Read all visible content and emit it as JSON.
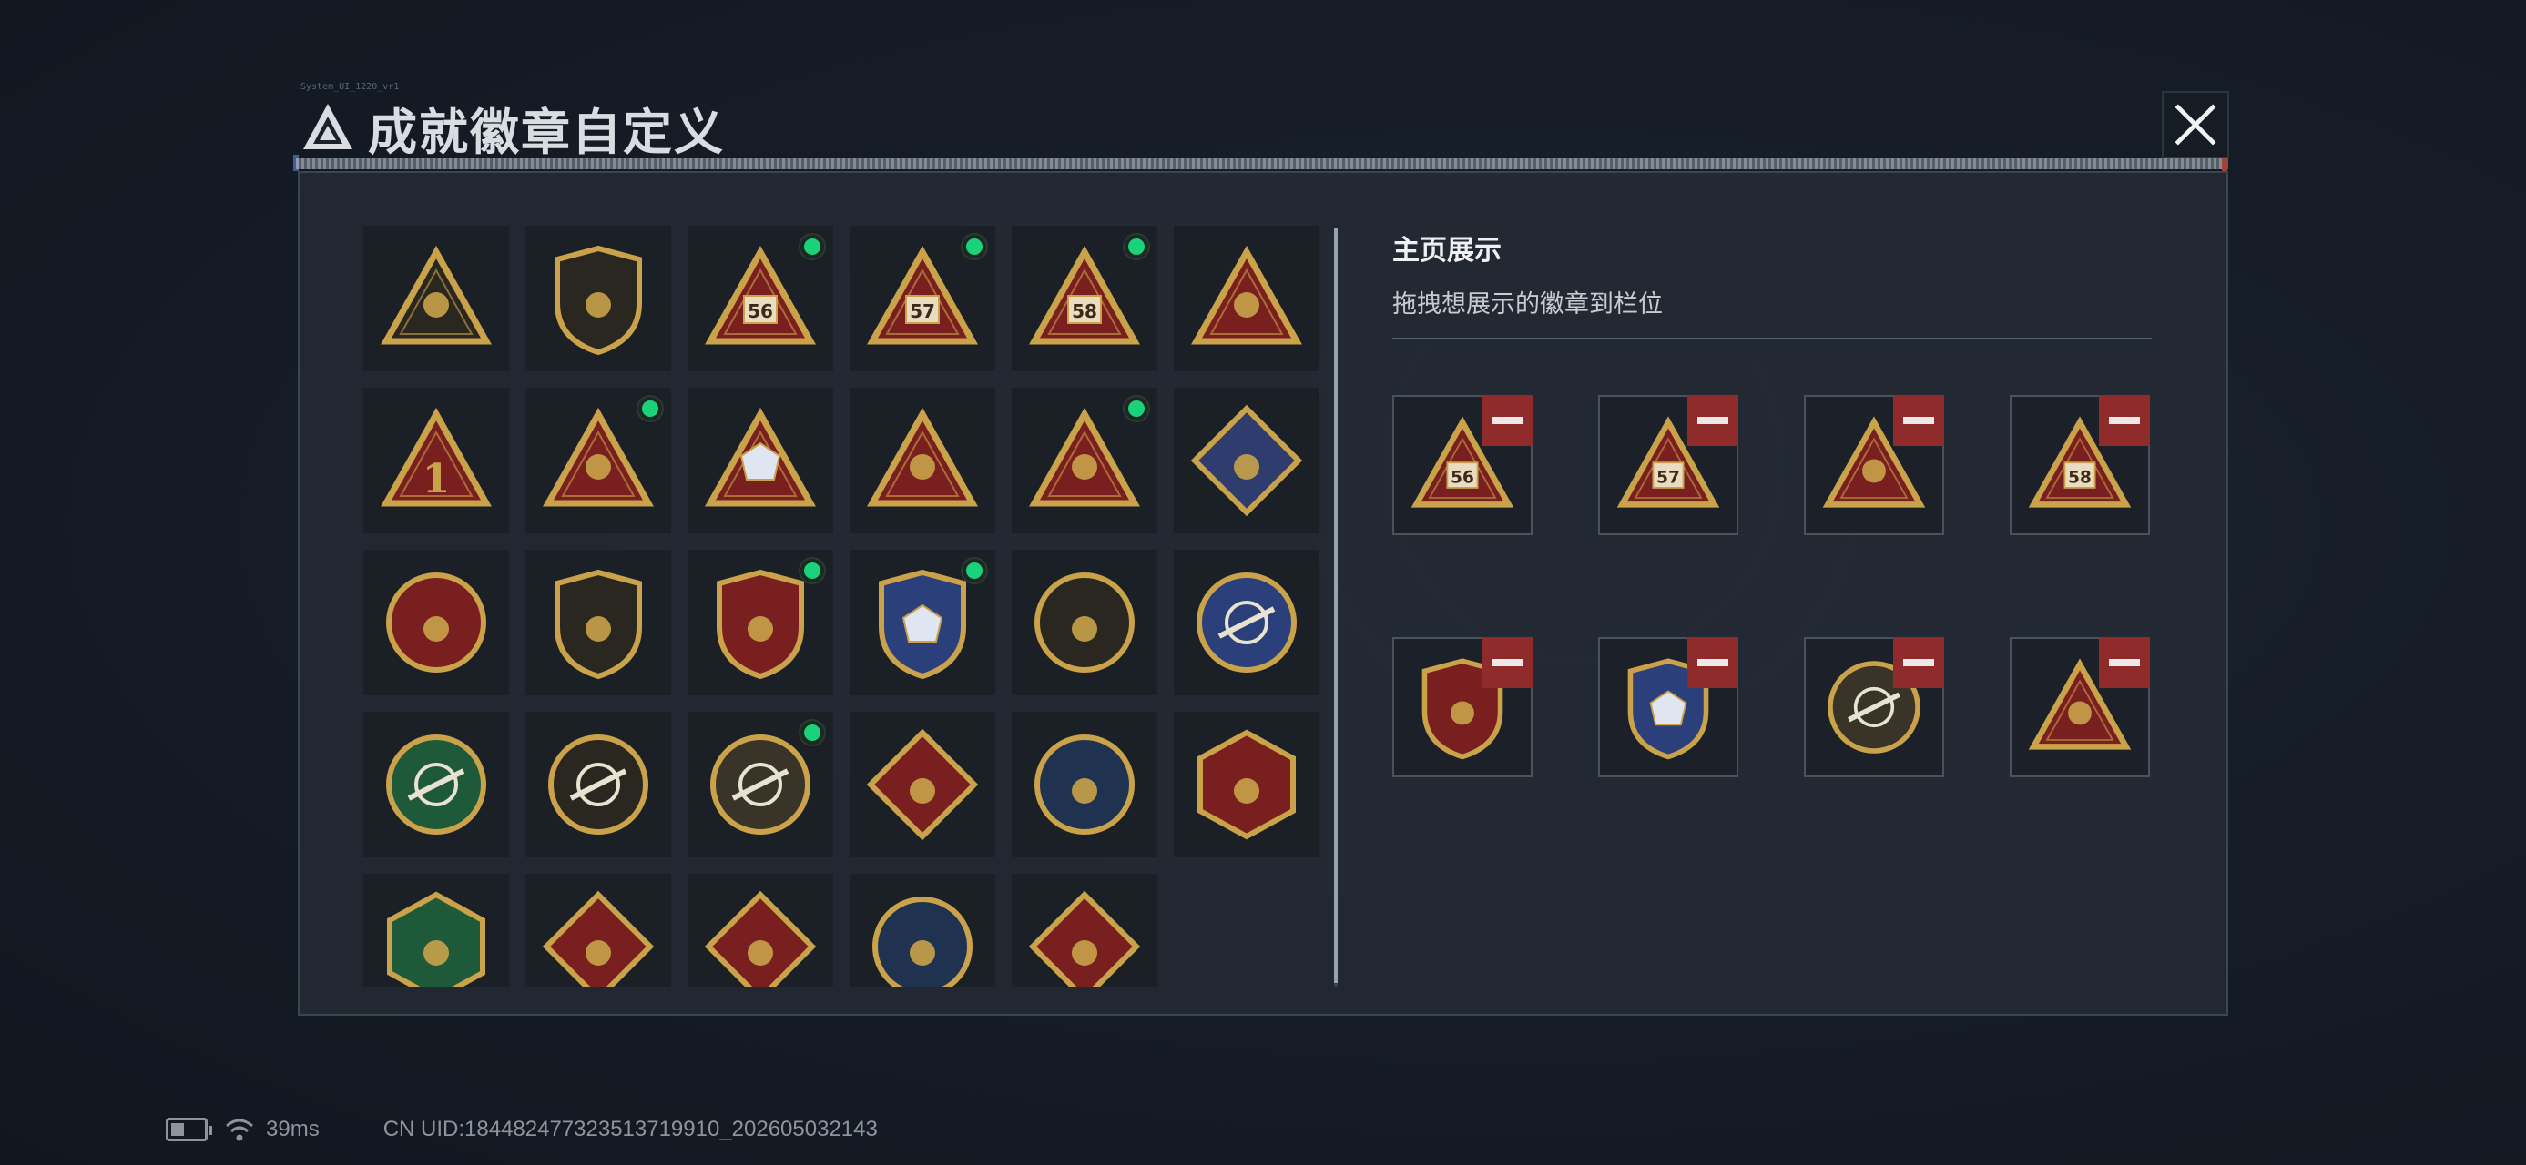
{
  "window": {
    "title": "成就徽章自定义",
    "tiny_code": "System_UI_1220_vr1",
    "close_icon": "close-icon"
  },
  "colors": {
    "gold": "#c9a24a",
    "dark_red": "#7a1f1f",
    "navy": "#2b3f7a",
    "green": "#1e5a3a",
    "new_dot": "#19d27a",
    "remove_red": "#8f2b2b"
  },
  "badge_grid": {
    "items": [
      {
        "icon": "triangle-logo-shield-badge",
        "new": false
      },
      {
        "icon": "helicopter-shield-badge",
        "new": false
      },
      {
        "icon": "s6-triangle-badge",
        "new": true
      },
      {
        "icon": "s7-triangle-badge",
        "new": true
      },
      {
        "icon": "s8-triangle-badge",
        "new": true
      },
      {
        "icon": "eagle-triangle-badge",
        "new": false
      },
      {
        "icon": "number-one-triangle-badge",
        "new": false
      },
      {
        "icon": "runner-triangle-badge",
        "new": true
      },
      {
        "icon": "gem-triangle-badge",
        "new": false
      },
      {
        "icon": "soldier-triangle-badge",
        "new": false
      },
      {
        "icon": "rocket-triangle-badge",
        "new": true
      },
      {
        "icon": "fist-diamond-badge",
        "new": false
      },
      {
        "icon": "star-medal-badge",
        "new": false
      },
      {
        "icon": "chevron-shield-badge",
        "new": false
      },
      {
        "icon": "wings-shield-red-badge",
        "new": true
      },
      {
        "icon": "gem-shield-blue-badge",
        "new": true
      },
      {
        "icon": "pearl-circle-badge",
        "new": false
      },
      {
        "icon": "rifle-crosshair-blue-badge",
        "new": false
      },
      {
        "icon": "rifle-crosshair-green-badge",
        "new": false
      },
      {
        "icon": "rifle-circle-badge",
        "new": false
      },
      {
        "icon": "missile-crosshair-gold-badge",
        "new": true
      },
      {
        "icon": "wolf-diamond-badge",
        "new": false
      },
      {
        "icon": "eagle-circle-badge",
        "new": false
      },
      {
        "icon": "wasp-hexagon-badge",
        "new": false
      },
      {
        "icon": "wasp-hexagon-green-badge",
        "new": false
      },
      {
        "icon": "dragon-diamond-badge",
        "new": false
      },
      {
        "icon": "sprinter-diamond-badge",
        "new": false
      },
      {
        "icon": "lynx-circle-badge",
        "new": false
      },
      {
        "icon": "backpack-diamond-badge",
        "new": false
      }
    ]
  },
  "showcase": {
    "title": "主页展示",
    "subtitle": "拖拽想展示的徽章到栏位",
    "slots": [
      {
        "icon": "s6-triangle-badge"
      },
      {
        "icon": "s7-triangle-badge"
      },
      {
        "icon": "runner-triangle-badge"
      },
      {
        "icon": "s8-triangle-badge"
      },
      {
        "icon": "wings-shield-red-badge"
      },
      {
        "icon": "gem-shield-blue-badge"
      },
      {
        "icon": "missile-crosshair-gold-badge"
      },
      {
        "icon": "rocket-triangle-badge"
      }
    ],
    "remove_icon": "minus-icon"
  },
  "status_bar": {
    "battery_icon": "battery-icon",
    "wifi_icon": "wifi-icon",
    "ping": "39ms",
    "uid": "CN UID:18448247732351371991​0_202605032143"
  }
}
